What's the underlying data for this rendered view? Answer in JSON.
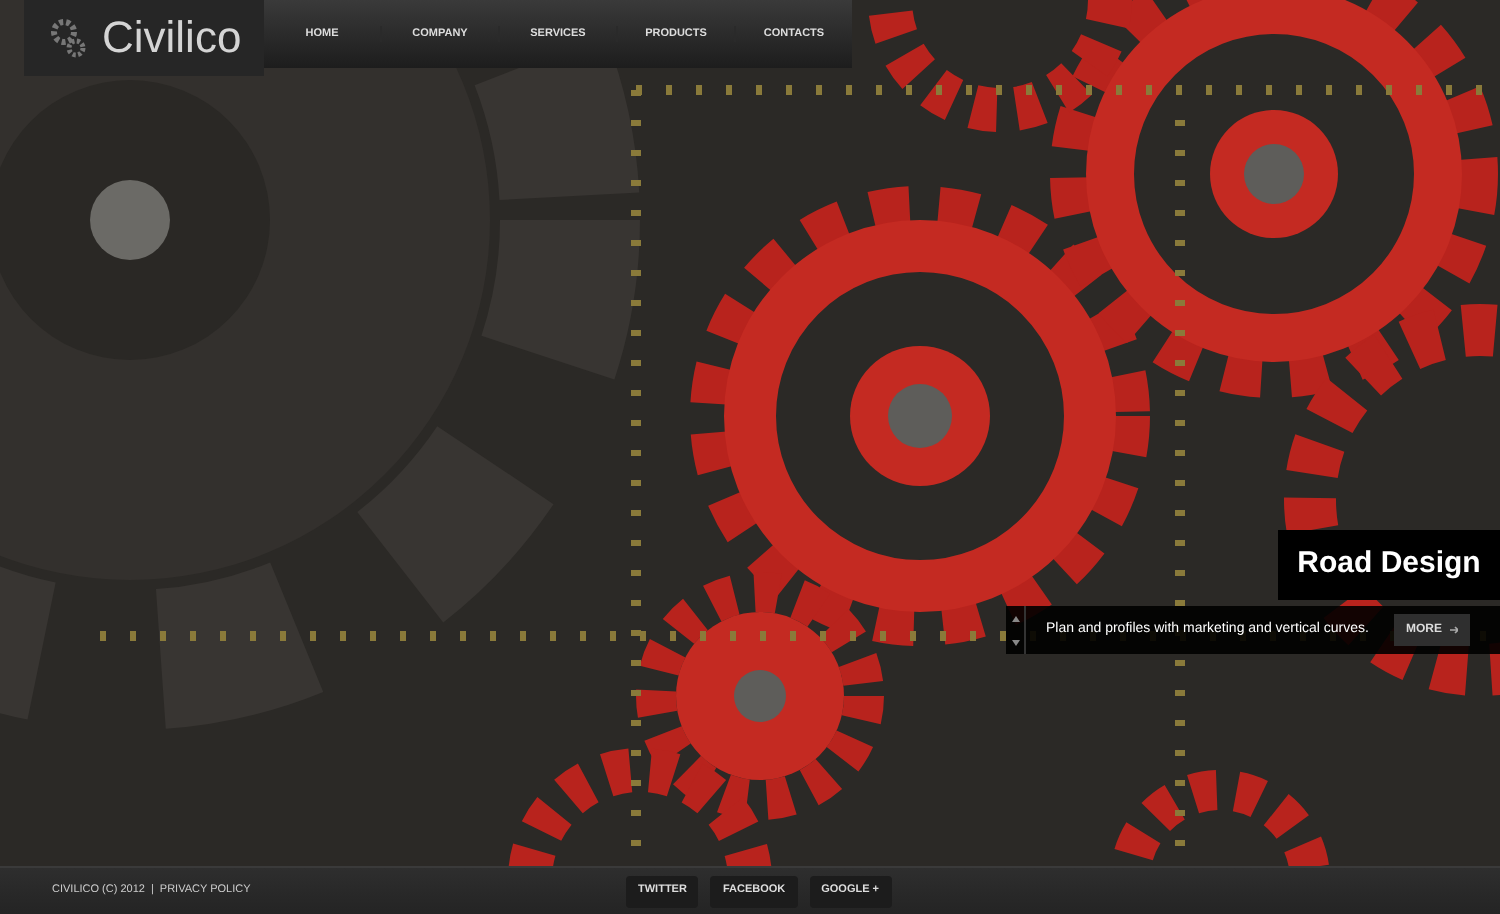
{
  "logo": {
    "text": "Civilico"
  },
  "nav": [
    {
      "label": "HOME"
    },
    {
      "label": "COMPANY"
    },
    {
      "label": "SERVICES"
    },
    {
      "label": "PRODUCTS"
    },
    {
      "label": "CONTACTS"
    }
  ],
  "slide": {
    "title": "Road Design",
    "description": "Plan and profiles with marketing and vertical curves.",
    "button": "MORE"
  },
  "footer": {
    "copyright": "CIVILICO (C) 2012",
    "privacy": "PRIVACY POLICY",
    "separator": "|",
    "social": [
      {
        "label": "TWITTER"
      },
      {
        "label": "FACEBOOK"
      },
      {
        "label": "GOOGLE +"
      }
    ]
  }
}
